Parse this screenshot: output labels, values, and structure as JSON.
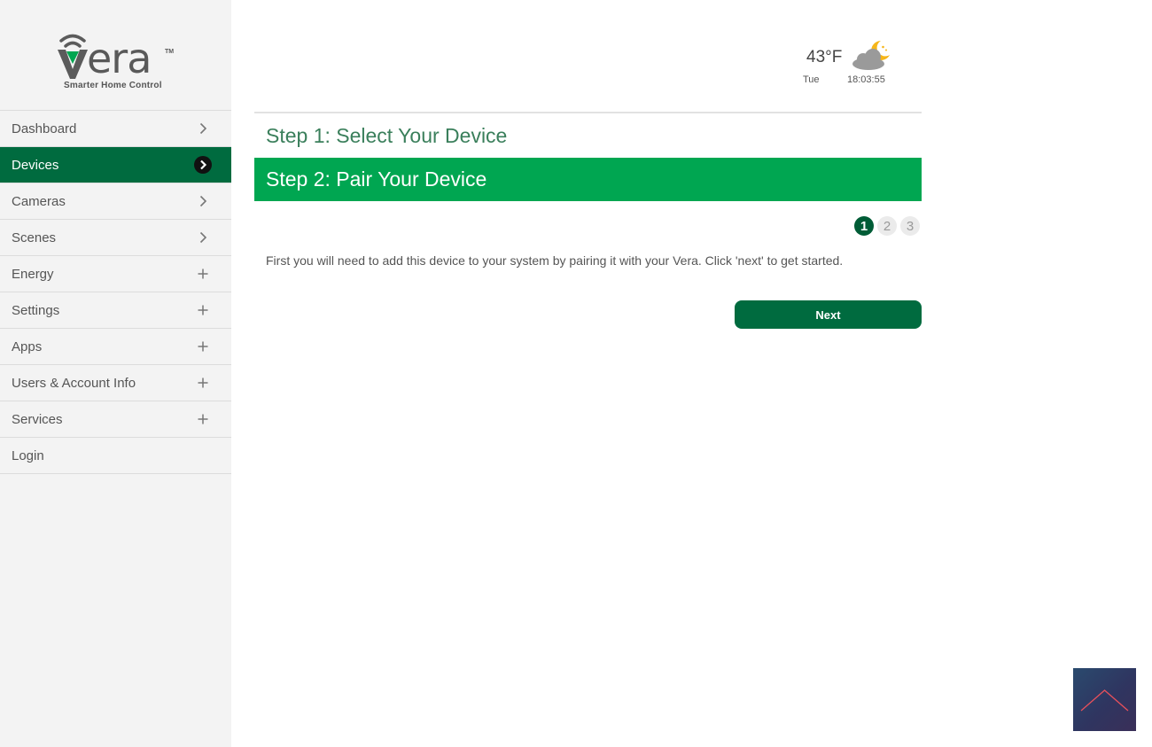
{
  "brand": {
    "wordmark": "era",
    "trademark": "TM",
    "tagline": "Smarter Home Control"
  },
  "sidebar": {
    "items": [
      {
        "label": "Dashboard",
        "indicator": "chevron-right-icon"
      },
      {
        "label": "Devices",
        "indicator": "chevron-right-icon",
        "active": true
      },
      {
        "label": "Cameras",
        "indicator": "chevron-right-icon"
      },
      {
        "label": "Scenes",
        "indicator": "chevron-right-icon"
      },
      {
        "label": "Energy",
        "indicator": "plus-icon"
      },
      {
        "label": "Settings",
        "indicator": "plus-icon"
      },
      {
        "label": "Apps",
        "indicator": "plus-icon"
      },
      {
        "label": "Users & Account Info",
        "indicator": "plus-icon"
      },
      {
        "label": "Services",
        "indicator": "plus-icon"
      },
      {
        "label": "Login",
        "indicator": ""
      }
    ]
  },
  "weather": {
    "temperature": "43°F",
    "day": "Tue",
    "time": "18:03:55",
    "icon": "partly-cloudy-night-icon"
  },
  "wizard": {
    "step1_title": "Step 1: Select Your Device",
    "step2_title": "Step 2: Pair Your Device",
    "progress": {
      "current": 1,
      "steps": [
        "1",
        "2",
        "3"
      ]
    },
    "instructions": "First you will need to add this device to your system by pairing it with your Vera. Click 'next' to get started.",
    "next_label": "Next"
  },
  "colors": {
    "accent_dark": "#006b3f",
    "accent_bright": "#00a651",
    "sidebar_bg": "#f3f3f3"
  }
}
